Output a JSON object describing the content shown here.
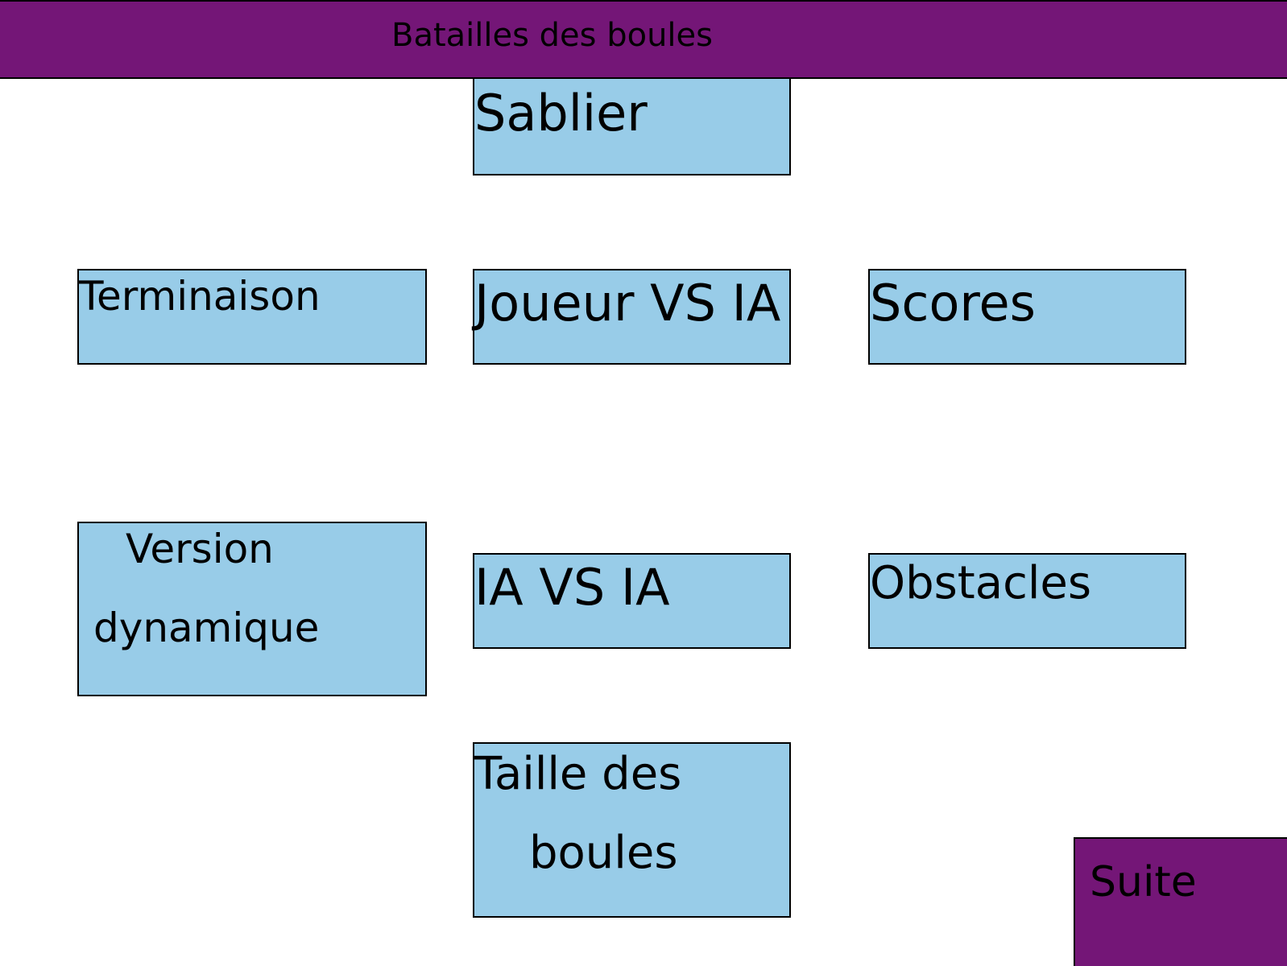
{
  "header": {
    "title": "Batailles des boules"
  },
  "options": {
    "sablier": "Sablier",
    "terminaison": "Terminaison",
    "joueur_vs_ia": "Joueur VS IA",
    "scores": "Scores",
    "version_line1": "Version",
    "version_line2": "dynamique",
    "ia_vs_ia": "IA VS IA",
    "obstacles": "Obstacles",
    "taille_line1": "Taille des",
    "taille_line2": "boules"
  },
  "footer": {
    "suite_label": "Suite"
  },
  "colors": {
    "header_bg": "#741677",
    "option_bg": "#98cce8",
    "suite_bg": "#741677"
  }
}
